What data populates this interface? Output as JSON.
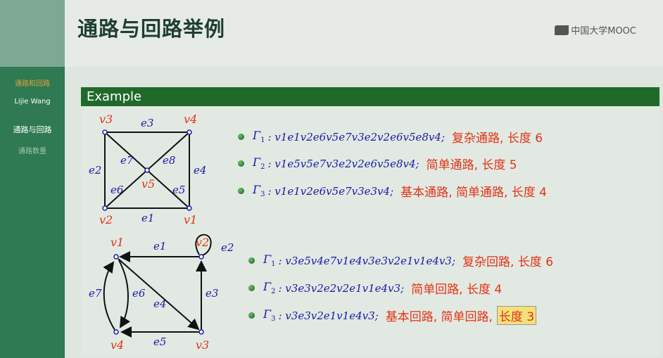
{
  "slide_title": "通路与回路举例",
  "logo_text": "中国大学MOOC",
  "sidebar": {
    "section": "通路和回路",
    "author": "Lijie Wang",
    "items": [
      "通路与回路",
      "通路数量"
    ]
  },
  "example_label": "Example",
  "graph1": {
    "vertices": [
      "v3",
      "v4",
      "v5",
      "v2",
      "v1"
    ],
    "edges": [
      "e3",
      "e2",
      "e4",
      "e7",
      "e8",
      "e6",
      "e5",
      "e1"
    ]
  },
  "graph2": {
    "vertices": [
      "v1",
      "v2",
      "v4",
      "v3"
    ],
    "edges": [
      "e1",
      "e2",
      "e7",
      "e6",
      "e4",
      "e3",
      "e5"
    ]
  },
  "paths1": [
    {
      "gamma": "Γ",
      "sub": "1",
      "seq": ": v1e1v2e6v5e7v3e2v2e6v5e8v4;",
      "desc": "复杂通路, 长度 6"
    },
    {
      "gamma": "Γ",
      "sub": "2",
      "seq": ": v1e5v5e7v3e2v2e6v5e8v4;",
      "desc": "简单通路, 长度 5"
    },
    {
      "gamma": "Γ",
      "sub": "3",
      "seq": ": v1e1v2e6v5e7v3e3v4;",
      "desc": "基本通路, 简单通路, 长度 4"
    }
  ],
  "paths2": [
    {
      "gamma": "Γ",
      "sub": "1",
      "seq": ": v3e5v4e7v1e4v3e3v2e1v1e4v3;",
      "desc": "复杂回路, 长度 6"
    },
    {
      "gamma": "Γ",
      "sub": "2",
      "seq": ": v3e3v2e2v2e1v1e4v3;",
      "desc": "简单回路, 长度 4"
    },
    {
      "gamma": "Γ",
      "sub": "3",
      "seq": ": v3e3v2e1v1e4v3;",
      "desc": "基本回路, 简单回路,",
      "highlight": "长度 3"
    }
  ],
  "colors": {
    "sidebar": "#2f7a52",
    "example_bar": "#1f6a2b",
    "vertex_label": "#e23216",
    "edge_label": "#1a1aa8",
    "description": "#e23216"
  }
}
